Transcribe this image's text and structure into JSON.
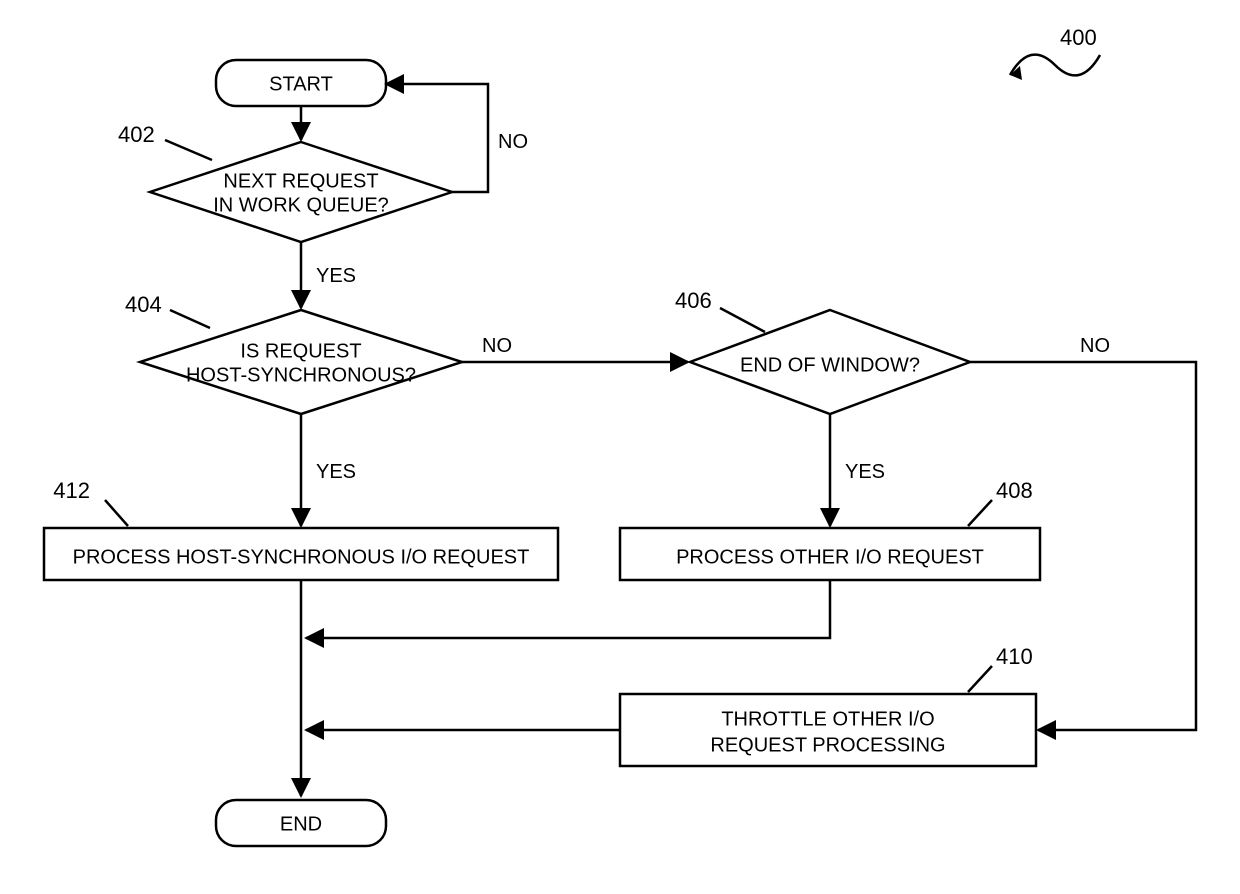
{
  "chart_data": {
    "type": "flowchart",
    "nodes": [
      {
        "id": "start",
        "shape": "terminator",
        "text": "START"
      },
      {
        "id": "d402",
        "shape": "decision",
        "text": "NEXT REQUEST IN WORK QUEUE?",
        "ref": "402"
      },
      {
        "id": "d404",
        "shape": "decision",
        "text": "IS REQUEST HOST-SYNCHRONOUS?",
        "ref": "404"
      },
      {
        "id": "d406",
        "shape": "decision",
        "text": "END OF WINDOW?",
        "ref": "406"
      },
      {
        "id": "p408",
        "shape": "process",
        "text": "PROCESS OTHER I/O REQUEST",
        "ref": "408"
      },
      {
        "id": "p410",
        "shape": "process",
        "text": "THROTTLE OTHER I/O REQUEST PROCESSING",
        "ref": "410"
      },
      {
        "id": "p412",
        "shape": "process",
        "text": "PROCESS HOST-SYNCHRONOUS I/O REQUEST",
        "ref": "412"
      },
      {
        "id": "end",
        "shape": "terminator",
        "text": "END"
      }
    ],
    "edges": [
      {
        "from": "start",
        "to": "d402"
      },
      {
        "from": "d402",
        "to": "start",
        "label": "NO"
      },
      {
        "from": "d402",
        "to": "d404",
        "label": "YES"
      },
      {
        "from": "d404",
        "to": "p412",
        "label": "YES"
      },
      {
        "from": "d404",
        "to": "d406",
        "label": "NO"
      },
      {
        "from": "d406",
        "to": "p408",
        "label": "YES"
      },
      {
        "from": "d406",
        "to": "p410_path",
        "label": "NO"
      },
      {
        "from": "p412",
        "to": "end"
      },
      {
        "from": "p408",
        "to": "merge_end"
      },
      {
        "from": "p410",
        "to": "merge_end"
      }
    ],
    "figure_ref": "400"
  },
  "nodes": {
    "start": "START",
    "end": "END",
    "d402_l1": "NEXT REQUEST",
    "d402_l2": "IN WORK QUEUE?",
    "d404_l1": "IS REQUEST",
    "d404_l2": "HOST-SYNCHRONOUS?",
    "d406": "END OF WINDOW?",
    "p412": "PROCESS HOST-SYNCHRONOUS I/O REQUEST",
    "p408": "PROCESS OTHER I/O REQUEST",
    "p410_l1": "THROTTLE OTHER I/O",
    "p410_l2": "REQUEST PROCESSING"
  },
  "labels": {
    "yes": "YES",
    "no": "NO"
  },
  "refs": {
    "r400": "400",
    "r402": "402",
    "r404": "404",
    "r406": "406",
    "r408": "408",
    "r410": "410",
    "r412": "412"
  }
}
